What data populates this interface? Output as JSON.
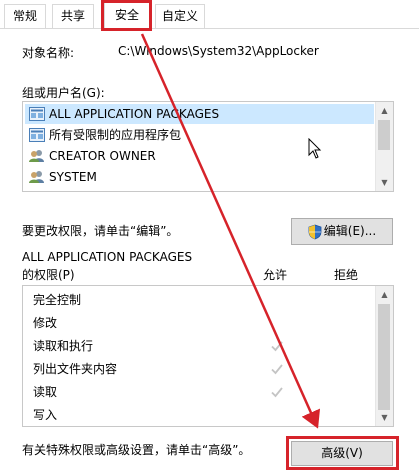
{
  "tabs": [
    "常规",
    "共享",
    "安全",
    "自定义"
  ],
  "object_label": "对象名称:",
  "object_value": "C:\\Windows\\System32\\AppLocker",
  "group_label": "组或用户名(G):",
  "groups": [
    {
      "name": "ALL APPLICATION PACKAGES",
      "icon": "package-group-icon",
      "selected": true
    },
    {
      "name": "所有受限制的应用程序包",
      "icon": "package-group-icon",
      "selected": false
    },
    {
      "name": "CREATOR OWNER",
      "icon": "users-icon",
      "selected": false
    },
    {
      "name": "SYSTEM",
      "icon": "users-icon",
      "selected": false
    }
  ],
  "edit_hint": "要更改权限，请单击“编辑”。",
  "edit_button": "编辑(E)...",
  "perm_title_line1": "ALL APPLICATION PACKAGES",
  "perm_title_line2": "的权限(P)",
  "perm_col_allow": "允许",
  "perm_col_deny": "拒绝",
  "permissions": [
    {
      "name": "完全控制",
      "allow": false,
      "deny": false
    },
    {
      "name": "修改",
      "allow": false,
      "deny": false
    },
    {
      "name": "读取和执行",
      "allow": true,
      "deny": false
    },
    {
      "name": "列出文件夹内容",
      "allow": true,
      "deny": false
    },
    {
      "name": "读取",
      "allow": true,
      "deny": false
    },
    {
      "name": "写入",
      "allow": false,
      "deny": false
    }
  ],
  "advanced_hint": "有关特殊权限或高级设置，请单击“高级”。",
  "advanced_button": "高级(V)",
  "colors": {
    "annotation": "#d6232a",
    "selection": "#cce8ff",
    "check_disabled": "#c4c4c4"
  }
}
